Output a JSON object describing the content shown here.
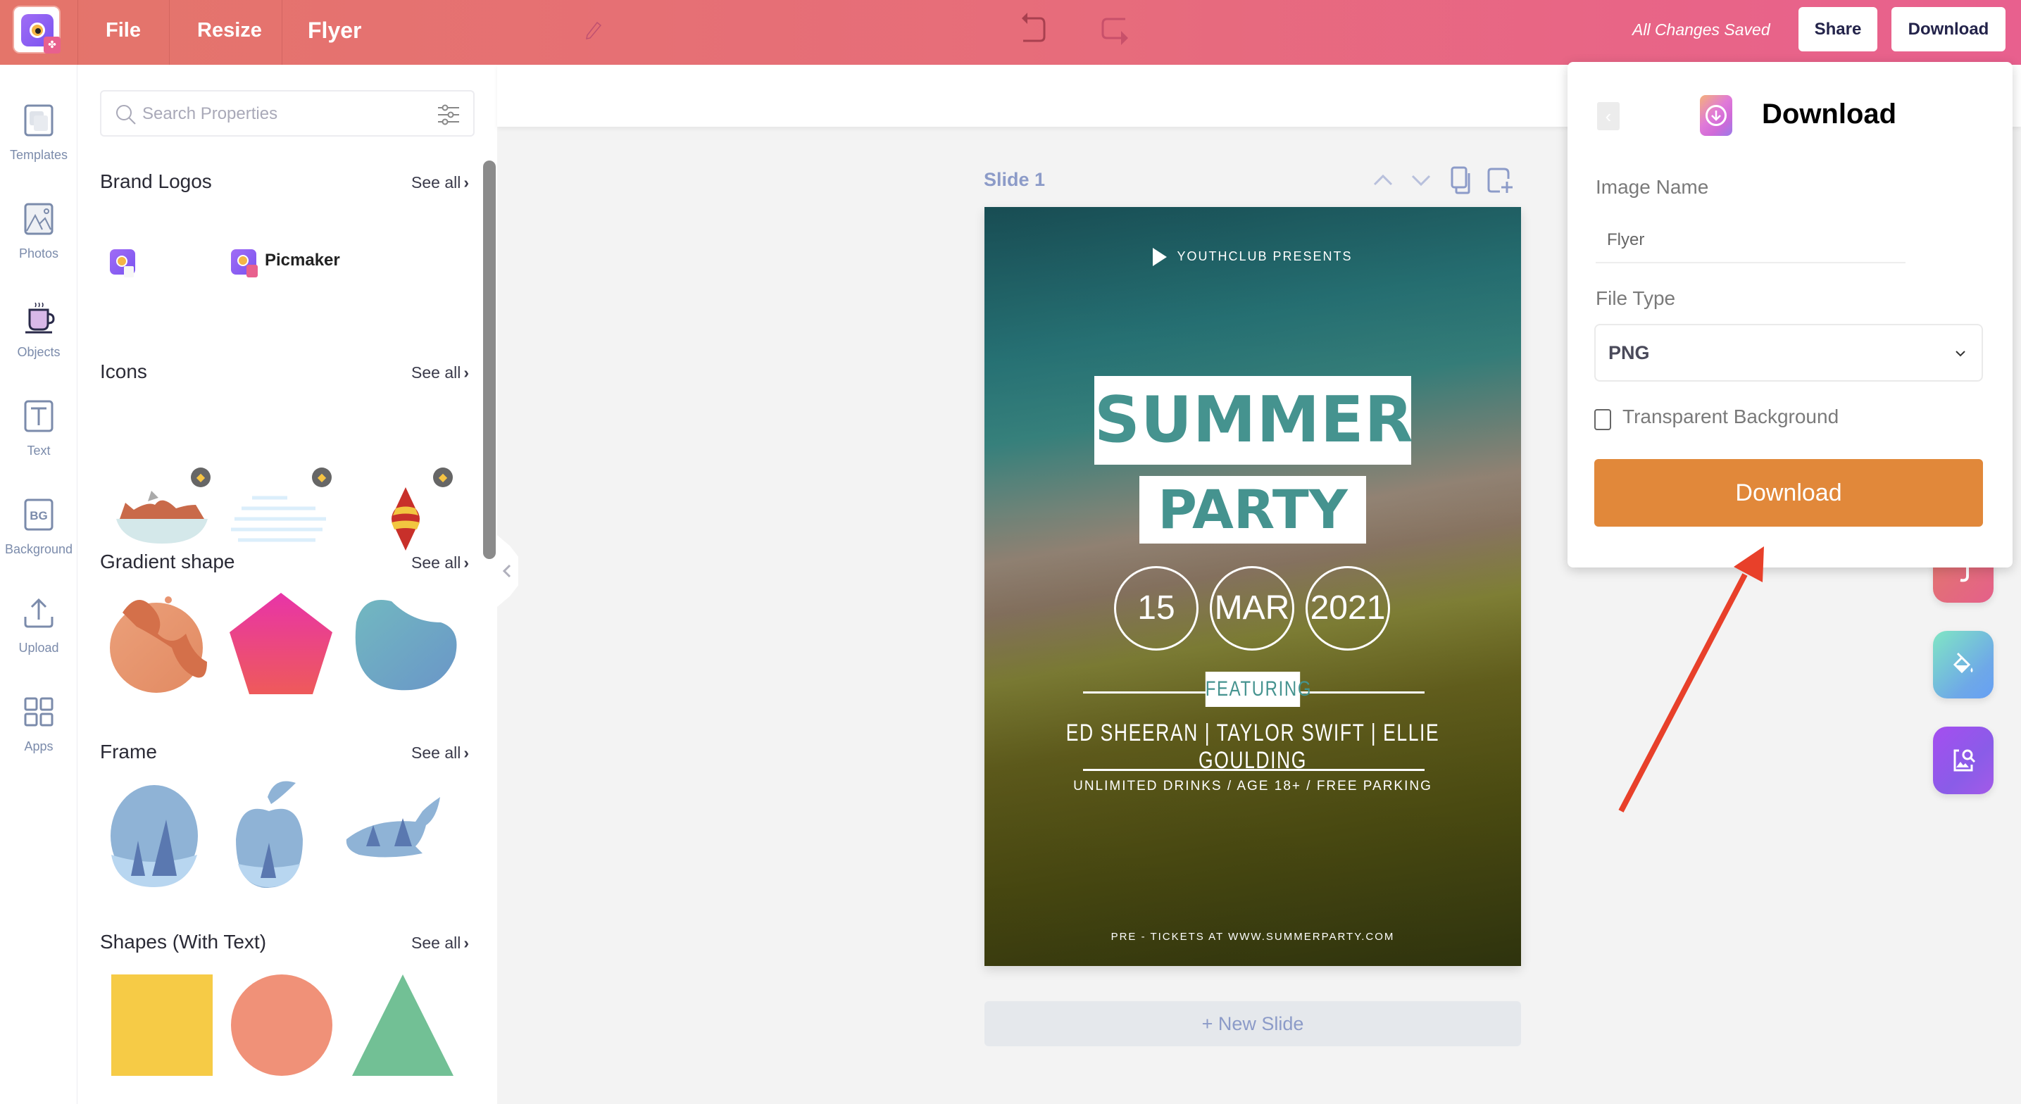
{
  "header": {
    "menu": [
      "File",
      "Resize"
    ],
    "document_title": "Flyer",
    "save_status": "All Changes Saved",
    "share_label": "Share",
    "download_label": "Download",
    "colors": {
      "gradient_start": "#e4756a",
      "gradient_end": "#e8608e"
    }
  },
  "rail": {
    "items": [
      {
        "label": "Templates",
        "icon": "templates-icon"
      },
      {
        "label": "Photos",
        "icon": "photos-icon"
      },
      {
        "label": "Objects",
        "icon": "objects-icon",
        "active": true
      },
      {
        "label": "Text",
        "icon": "text-icon"
      },
      {
        "label": "Background",
        "icon": "background-icon"
      },
      {
        "label": "Upload",
        "icon": "upload-icon"
      },
      {
        "label": "Apps",
        "icon": "apps-icon"
      }
    ]
  },
  "panel": {
    "search_placeholder": "Search Properties",
    "see_all": "See all",
    "sections": [
      {
        "title": "Brand Logos",
        "items": [
          "Picmaker icon logo",
          "Picmaker"
        ]
      },
      {
        "title": "Icons",
        "items": [
          "roast meat",
          "cloud lines",
          "ornament"
        ]
      },
      {
        "title": "Gradient shape",
        "items": [
          "orange blob",
          "pink pentagon",
          "blue blob"
        ]
      },
      {
        "title": "Frame",
        "items": [
          "circle forest frame",
          "apple forest frame",
          "whale forest frame"
        ]
      },
      {
        "title": "Shapes (With Text)",
        "items": [
          "yellow square",
          "salmon circle",
          "green triangle"
        ]
      }
    ],
    "brand_logo_text": "Picmaker"
  },
  "canvas": {
    "slide_label": "Slide 1",
    "new_slide_label": "+ New Slide",
    "flyer": {
      "presents": "YOUTHCLUB PRESENTS",
      "title_line1": "SUMMER",
      "title_line2": "PARTY",
      "day": "15",
      "month": "MAR",
      "year": "2021",
      "featuring": "FEATURING",
      "artists": "ED SHEERAN | TAYLOR SWIFT | ELLIE GOULDING",
      "info": "UNLIMITED DRINKS / AGE 18+ / FREE PARKING",
      "tickets": "PRE - TICKETS AT WWW.SUMMERPARTY.COM",
      "accent_color": "#45938f"
    }
  },
  "download_panel": {
    "title": "Download",
    "image_name_label": "Image Name",
    "image_name_value": "Flyer",
    "file_type_label": "File Type",
    "file_type_value": "PNG",
    "transparent_label": "Transparent Background",
    "transparent_checked": false,
    "download_button": "Download",
    "button_color": "#e1883a"
  },
  "floating_tools": [
    "font-tool",
    "paint-bucket-tool",
    "image-search-tool"
  ],
  "annotation": {
    "arrow_color": "#e8402a"
  }
}
